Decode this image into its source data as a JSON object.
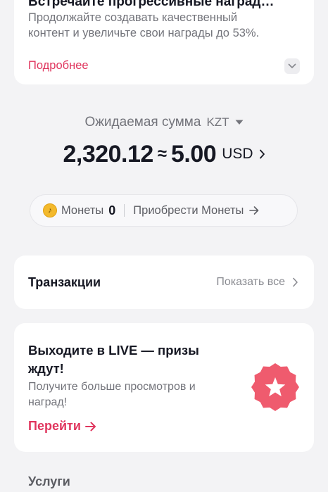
{
  "promo": {
    "title": "Встречайте прогрессивные наград…",
    "body": "Продолжайте создавать качественный контент и увеличьте свои награды до 53%.",
    "link": "Подробнее"
  },
  "balance": {
    "expected_label": "Ожидаемая сумма",
    "currency": "KZT",
    "amount_local": "2,320.12",
    "approx": "≈",
    "amount_usd": "5.00",
    "usd_code": "USD"
  },
  "coins": {
    "label": "Монеты",
    "value": "0",
    "buy_label": "Приобрести Монеты"
  },
  "transactions": {
    "title": "Транзакции",
    "show_all": "Показать все"
  },
  "live": {
    "title": "Выходите в LIVE — призы ждут!",
    "body": "Получите больше просмотров и наград!",
    "link": "Перейти"
  },
  "services": {
    "title": "Услуги"
  },
  "colors": {
    "accent": "#e0365e",
    "badge": "#ef5b6e",
    "coin": "#f3b92c"
  }
}
